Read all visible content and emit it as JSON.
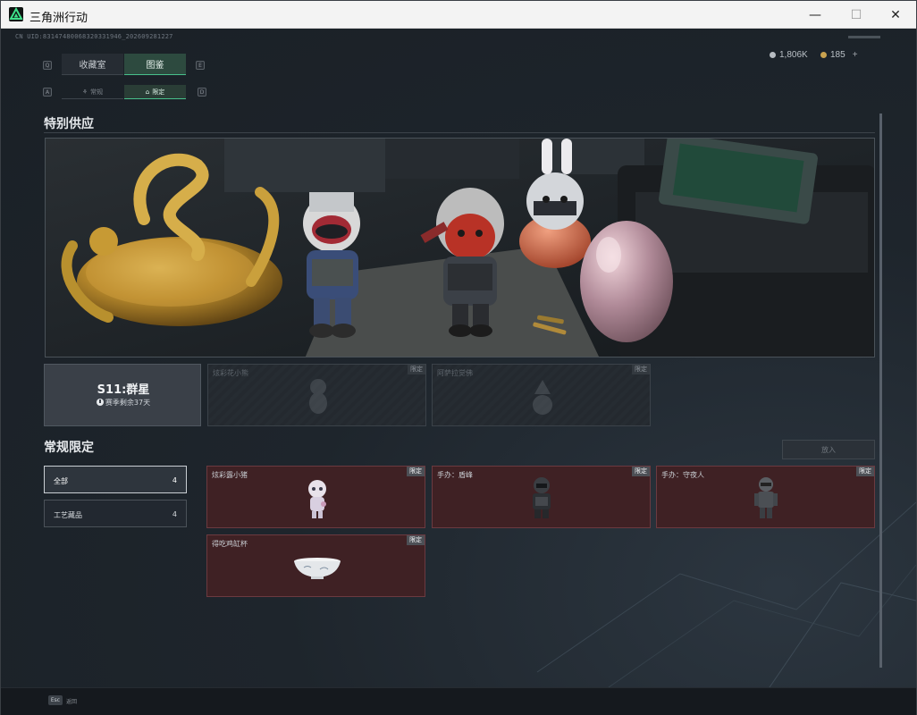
{
  "window": {
    "title": "三角洲行动",
    "minimize": "—",
    "maximize": "☐",
    "close": "✕"
  },
  "header": {
    "uid": "CN UID:8314748006832033194​6_2026092812​27",
    "currency1": "1,806K",
    "currency2": "185",
    "currency2_plus": "+"
  },
  "tabs": {
    "primary": [
      {
        "label": "收藏室",
        "active": false
      },
      {
        "label": "图鉴",
        "active": true
      }
    ],
    "sub": [
      {
        "label": "常规",
        "active": false
      },
      {
        "label": "限定",
        "active": true
      }
    ],
    "key_hints": [
      "Q",
      "E",
      "A",
      "D"
    ]
  },
  "special_supply": {
    "title": "特别供应",
    "season": {
      "name": "S11:群星",
      "remaining": "赛季剩余37天"
    },
    "locked_items": [
      {
        "label": "炫彩花小熊",
        "tag": "限定"
      },
      {
        "label": "阿萨拉觉佛",
        "tag": "限定"
      }
    ]
  },
  "regular_limited": {
    "title": "常规限定",
    "put_button": "放入",
    "filters": [
      {
        "label": "全部",
        "count": "4",
        "active": true
      },
      {
        "label": "工艺藏品",
        "count": "4",
        "active": false
      }
    ],
    "items": [
      {
        "label": "炫彩露小猪",
        "tag": "限定",
        "icon": "doll-figure-icon"
      },
      {
        "label": "手办：盾峰",
        "tag": "限定",
        "icon": "armored-soldier-figure-icon"
      },
      {
        "label": "手办：守夜人",
        "tag": "限定",
        "icon": "soldier-figure-icon"
      },
      {
        "label": "得吃鸡缸杯",
        "tag": "限定",
        "icon": "porcelain-bowl-icon"
      }
    ]
  },
  "footer": {
    "esc_key": "Esc",
    "esc_label": "返回"
  }
}
